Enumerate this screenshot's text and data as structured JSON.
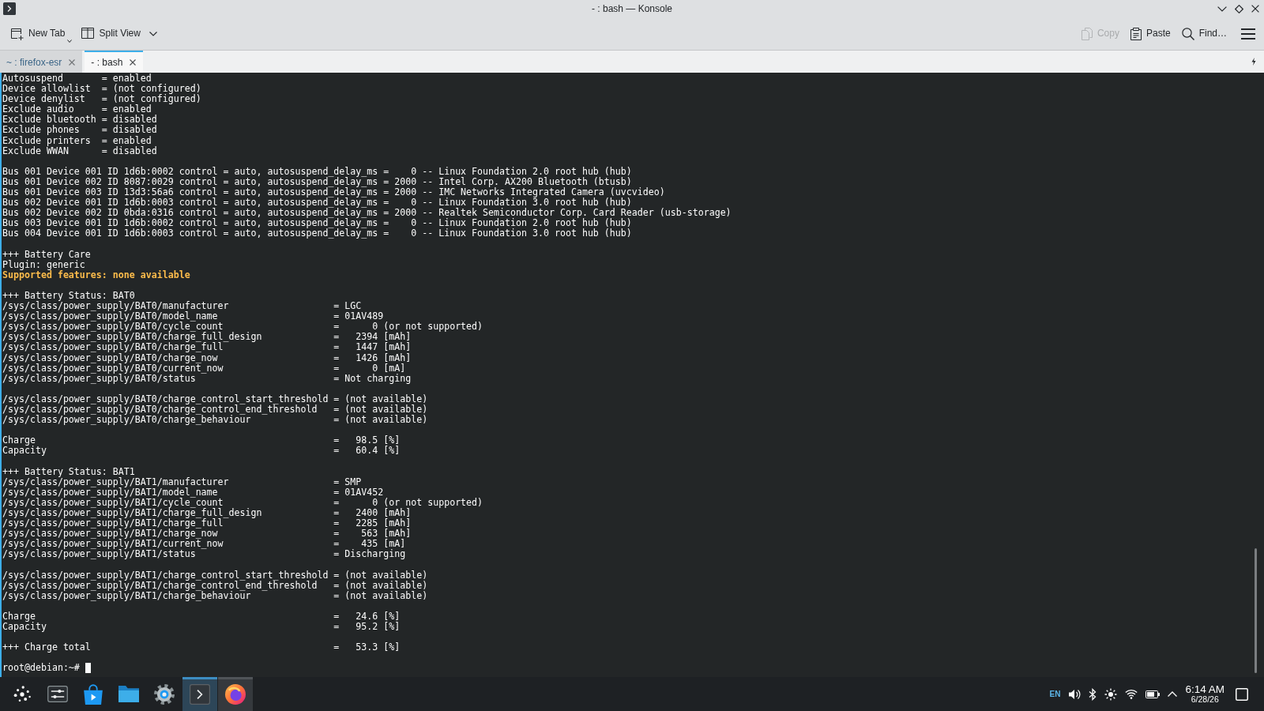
{
  "window": {
    "title": "- : bash — Konsole"
  },
  "toolbar": {
    "left": [
      {
        "label": "New Tab",
        "disabled": false
      },
      {
        "label": "Split View",
        "disabled": false
      }
    ],
    "right": [
      {
        "label": "Copy",
        "disabled": true
      },
      {
        "label": "Paste",
        "disabled": false
      },
      {
        "label": "Find…",
        "disabled": false
      }
    ]
  },
  "tabs": [
    {
      "label": "~ : firefox-esr",
      "selected": false
    },
    {
      "label": "- : bash",
      "selected": true
    }
  ],
  "terminal": {
    "sections": [
      {
        "lines": [
          "Autosuspend       = enabled",
          "Device allowlist  = (not configured)",
          "Device denylist   = (not configured)",
          "Exclude audio     = enabled",
          "Exclude bluetooth = disabled",
          "Exclude phones    = disabled",
          "Exclude printers  = enabled",
          "Exclude WWAN      = disabled"
        ]
      },
      {
        "lines": [
          "Bus 001 Device 001 ID 1d6b:0002 control = auto, autosuspend_delay_ms =    0 -- Linux Foundation 2.0 root hub (hub)",
          "Bus 001 Device 002 ID 8087:0029 control = auto, autosuspend_delay_ms = 2000 -- Intel Corp. AX200 Bluetooth (btusb)",
          "Bus 001 Device 003 ID 13d3:56a6 control = auto, autosuspend_delay_ms = 2000 -- IMC Networks Integrated Camera (uvcvideo)",
          "Bus 002 Device 001 ID 1d6b:0003 control = auto, autosuspend_delay_ms =    0 -- Linux Foundation 3.0 root hub (hub)",
          "Bus 002 Device 002 ID 0bda:0316 control = auto, autosuspend_delay_ms = 2000 -- Realtek Semiconductor Corp. Card Reader (usb-storage)",
          "Bus 003 Device 001 ID 1d6b:0002 control = auto, autosuspend_delay_ms =    0 -- Linux Foundation 2.0 root hub (hub)",
          "Bus 004 Device 001 ID 1d6b:0003 control = auto, autosuspend_delay_ms =    0 -- Linux Foundation 3.0 root hub (hub)"
        ]
      },
      {
        "lines": [
          "+++ Battery Care",
          "Plugin: generic"
        ],
        "notice": "Supported features: none available"
      },
      {
        "lines": [
          "+++ Battery Status: BAT0",
          "/sys/class/power_supply/BAT0/manufacturer                   = LGC",
          "/sys/class/power_supply/BAT0/model_name                     = 01AV489",
          "/sys/class/power_supply/BAT0/cycle_count                    =      0 (or not supported)",
          "/sys/class/power_supply/BAT0/charge_full_design             =   2394 [mAh]",
          "/sys/class/power_supply/BAT0/charge_full                    =   1447 [mAh]",
          "/sys/class/power_supply/BAT0/charge_now                     =   1426 [mAh]",
          "/sys/class/power_supply/BAT0/current_now                    =      0 [mA]",
          "/sys/class/power_supply/BAT0/status                         = Not charging"
        ]
      },
      {
        "lines": [
          "/sys/class/power_supply/BAT0/charge_control_start_threshold = (not available)",
          "/sys/class/power_supply/BAT0/charge_control_end_threshold   = (not available)",
          "/sys/class/power_supply/BAT0/charge_behaviour               = (not available)"
        ]
      },
      {
        "lines": [
          "Charge                                                      =   98.5 [%]",
          "Capacity                                                    =   60.4 [%]"
        ]
      },
      {
        "lines": [
          "+++ Battery Status: BAT1",
          "/sys/class/power_supply/BAT1/manufacturer                   = SMP",
          "/sys/class/power_supply/BAT1/model_name                     = 01AV452",
          "/sys/class/power_supply/BAT1/cycle_count                    =      0 (or not supported)",
          "/sys/class/power_supply/BAT1/charge_full_design             =   2400 [mAh]",
          "/sys/class/power_supply/BAT1/charge_full                    =   2285 [mAh]",
          "/sys/class/power_supply/BAT1/charge_now                     =    563 [mAh]",
          "/sys/class/power_supply/BAT1/current_now                    =    435 [mA]",
          "/sys/class/power_supply/BAT1/status                         = Discharging"
        ]
      },
      {
        "lines": [
          "/sys/class/power_supply/BAT1/charge_control_start_threshold = (not available)",
          "/sys/class/power_supply/BAT1/charge_control_end_threshold   = (not available)",
          "/sys/class/power_supply/BAT1/charge_behaviour               = (not available)"
        ]
      },
      {
        "lines": [
          "Charge                                                      =   24.6 [%]",
          "Capacity                                                    =   95.2 [%]"
        ]
      },
      {
        "lines": [
          "+++ Charge total                                            =   53.3 [%]"
        ]
      }
    ],
    "prompt": "root@debian:~#"
  },
  "taskbar": {
    "tasks": [
      {
        "open": false,
        "selected": false
      },
      {
        "open": false,
        "selected": false
      },
      {
        "open": false,
        "selected": false
      },
      {
        "open": true,
        "selected": true
      },
      {
        "open": true,
        "selected": false
      }
    ],
    "tray": {
      "keyboard_layout": "EN"
    },
    "clock": {
      "time": "6:14 AM",
      "date": "6/28/26"
    }
  }
}
